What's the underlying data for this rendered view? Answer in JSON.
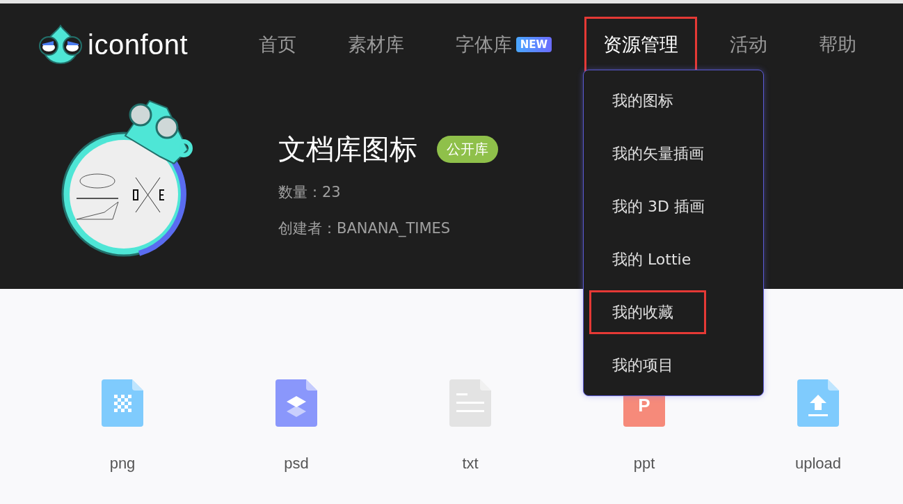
{
  "logo": {
    "text": "iconfont"
  },
  "nav": [
    {
      "label": "首页",
      "selected": false,
      "highlighted": false
    },
    {
      "label": "素材库",
      "selected": false,
      "highlighted": false
    },
    {
      "label": "字体库",
      "selected": false,
      "highlighted": false,
      "badge": "NEW"
    },
    {
      "label": "资源管理",
      "selected": true,
      "highlighted": true
    },
    {
      "label": "活动",
      "selected": false,
      "highlighted": false
    },
    {
      "label": "帮助",
      "selected": false,
      "highlighted": false
    }
  ],
  "dropdown": [
    {
      "label": "我的图标",
      "highlighted": false
    },
    {
      "label": "我的矢量插画",
      "highlighted": false
    },
    {
      "label": "我的 3D 插画",
      "highlighted": false
    },
    {
      "label": "我的 Lottie",
      "highlighted": false
    },
    {
      "label": "我的收藏",
      "highlighted": true
    },
    {
      "label": "我的项目",
      "highlighted": false
    }
  ],
  "library": {
    "title": "文档库图标",
    "tag": "公开库",
    "count": "数量：23",
    "creator": "创建者：BANANA_TIMES"
  },
  "files": [
    {
      "label": "png",
      "kind": "image",
      "color": "#7fcbfd"
    },
    {
      "label": "psd",
      "kind": "layers",
      "color": "#8a97fb"
    },
    {
      "label": "txt",
      "kind": "text",
      "color": "#e3e3e3"
    },
    {
      "label": "ppt",
      "kind": "letter",
      "glyph": "P",
      "color": "#f68a7a"
    },
    {
      "label": "upload",
      "kind": "upload",
      "color": "#7fcbfd"
    }
  ]
}
